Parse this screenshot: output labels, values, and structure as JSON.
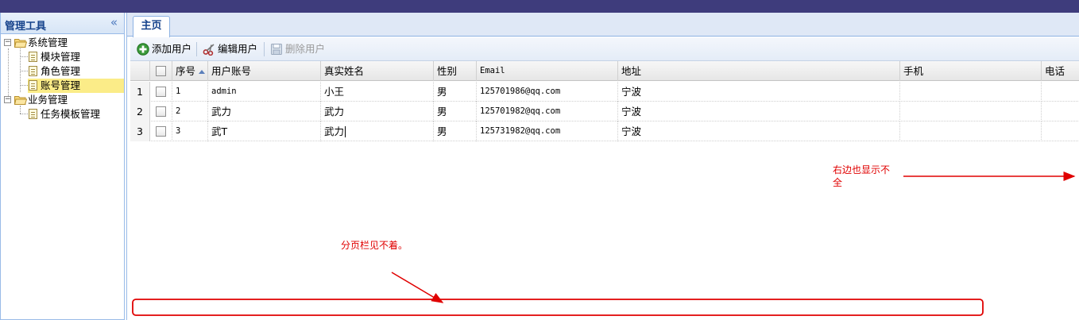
{
  "sidebar": {
    "title": "管理工具",
    "collapse_icon": "«",
    "tree": [
      {
        "label": "系统管理",
        "type": "folder",
        "expanded": true
      },
      {
        "label": "模块管理",
        "type": "leaf"
      },
      {
        "label": "角色管理",
        "type": "leaf"
      },
      {
        "label": "账号管理",
        "type": "leaf",
        "selected": true
      },
      {
        "label": "业务管理",
        "type": "folder",
        "expanded": true
      },
      {
        "label": "任务模板管理",
        "type": "leaf"
      }
    ]
  },
  "tabs": [
    {
      "label": "主页",
      "active": true
    }
  ],
  "toolbar": {
    "add_label": "添加用户",
    "edit_label": "编辑用户",
    "delete_label": "删除用户",
    "delete_disabled": true
  },
  "grid": {
    "columns": [
      "",
      "",
      "序号",
      "用户账号",
      "真实姓名",
      "性别",
      "Email",
      "地址",
      "手机",
      "电话"
    ],
    "sorted_column": "序号",
    "sort_direction": "asc",
    "rows": [
      {
        "rownum": "1",
        "seq": "1",
        "account": "admin",
        "name": "小王",
        "gender": "男",
        "email": "125701986@qq.com",
        "address": "宁波",
        "mobile": "",
        "phone": ""
      },
      {
        "rownum": "2",
        "seq": "2",
        "account": "武力",
        "name": "武力",
        "gender": "男",
        "email": "125701982@qq.com",
        "address": "宁波",
        "mobile": "",
        "phone": ""
      },
      {
        "rownum": "3",
        "seq": "3",
        "account": "武T",
        "name": "武力",
        "gender": "男",
        "email": "125731982@qq.com",
        "address": "宁波",
        "mobile": "",
        "phone": ""
      }
    ]
  },
  "annotations": {
    "right_note": "右边也显示不全",
    "pager_note": "分页栏见不着。",
    "color": "#e00000"
  },
  "colors": {
    "topbar": "#3e3c7c",
    "panel_border": "#99bbe8",
    "selected_row": "#fbec88",
    "header_text": "#15428b"
  }
}
